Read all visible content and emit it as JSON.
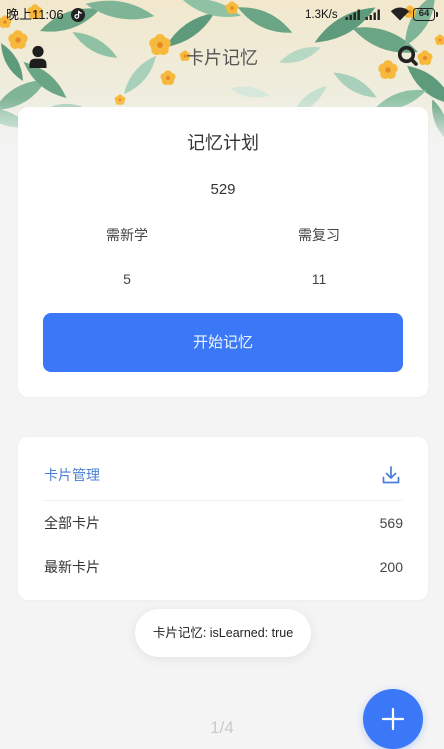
{
  "status_bar": {
    "time": "晚上11:06",
    "network_speed": "1.3K/s",
    "battery": "64",
    "icons": [
      "tiktok-notification-icon",
      "signal-icon",
      "signal-icon",
      "wifi-icon",
      "battery-icon"
    ]
  },
  "header": {
    "title": "卡片记忆",
    "left_icon": "user-icon",
    "right_icon": "search-icon"
  },
  "plan_card": {
    "title": "记忆计划",
    "total": "529",
    "new_label": "需新学",
    "new_count": "5",
    "review_label": "需复习",
    "review_count": "11",
    "start_button": "开始记忆"
  },
  "manage_card": {
    "title": "卡片管理",
    "action_icon": "download-icon",
    "items": [
      {
        "label": "全部卡片",
        "value": "569"
      },
      {
        "label": "最新卡片",
        "value": "200"
      }
    ]
  },
  "toast": {
    "text": "卡片记忆: isLearned: true"
  },
  "pager": {
    "text": "1/4"
  },
  "fab": {
    "icon": "plus-icon"
  },
  "colors": {
    "accent": "#3b78f7",
    "link": "#4a7fd5",
    "background": "#f4f4f4",
    "text": "#333333"
  }
}
